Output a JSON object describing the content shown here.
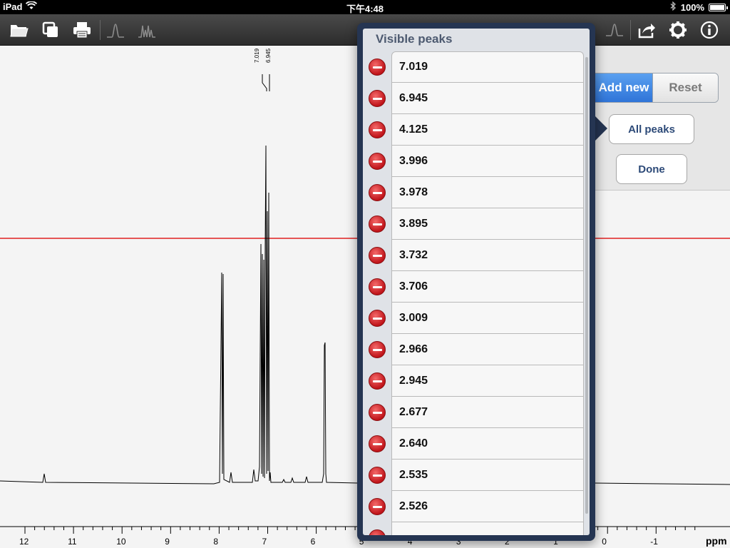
{
  "status": {
    "device": "iPad",
    "time": "下午4:48",
    "battery": "100%"
  },
  "toolbar": {
    "left_icons": [
      "folder-open-icon",
      "copy-window-icon",
      "print-icon",
      "peak-single-icon",
      "peak-multiplet-icon"
    ],
    "right_icons": [
      "peak-icon",
      "share-icon",
      "gear-icon",
      "info-icon"
    ]
  },
  "spectrum": {
    "axis_unit": "ppm",
    "ticks": [
      "12",
      "11",
      "10",
      "9",
      "8",
      "7",
      "6",
      "5",
      "4",
      "3",
      "2",
      "1",
      "0",
      "-1"
    ],
    "peak_labels": [
      "7.019",
      "6.945"
    ]
  },
  "popover": {
    "title": "Visible peaks",
    "peaks": [
      "7.019",
      "6.945",
      "4.125",
      "3.996",
      "3.978",
      "3.895",
      "3.732",
      "3.706",
      "3.009",
      "2.966",
      "2.945",
      "2.677",
      "2.640",
      "2.535",
      "2.526"
    ]
  },
  "panel": {
    "add_new": "Add new",
    "reset": "Reset",
    "all_peaks": "All peaks",
    "done": "Done"
  },
  "colors": {
    "threshold_line": "#e02020",
    "popover_frame": "#253552",
    "delete_button": "#c0141a",
    "add_new_active": "#2f74d8"
  }
}
